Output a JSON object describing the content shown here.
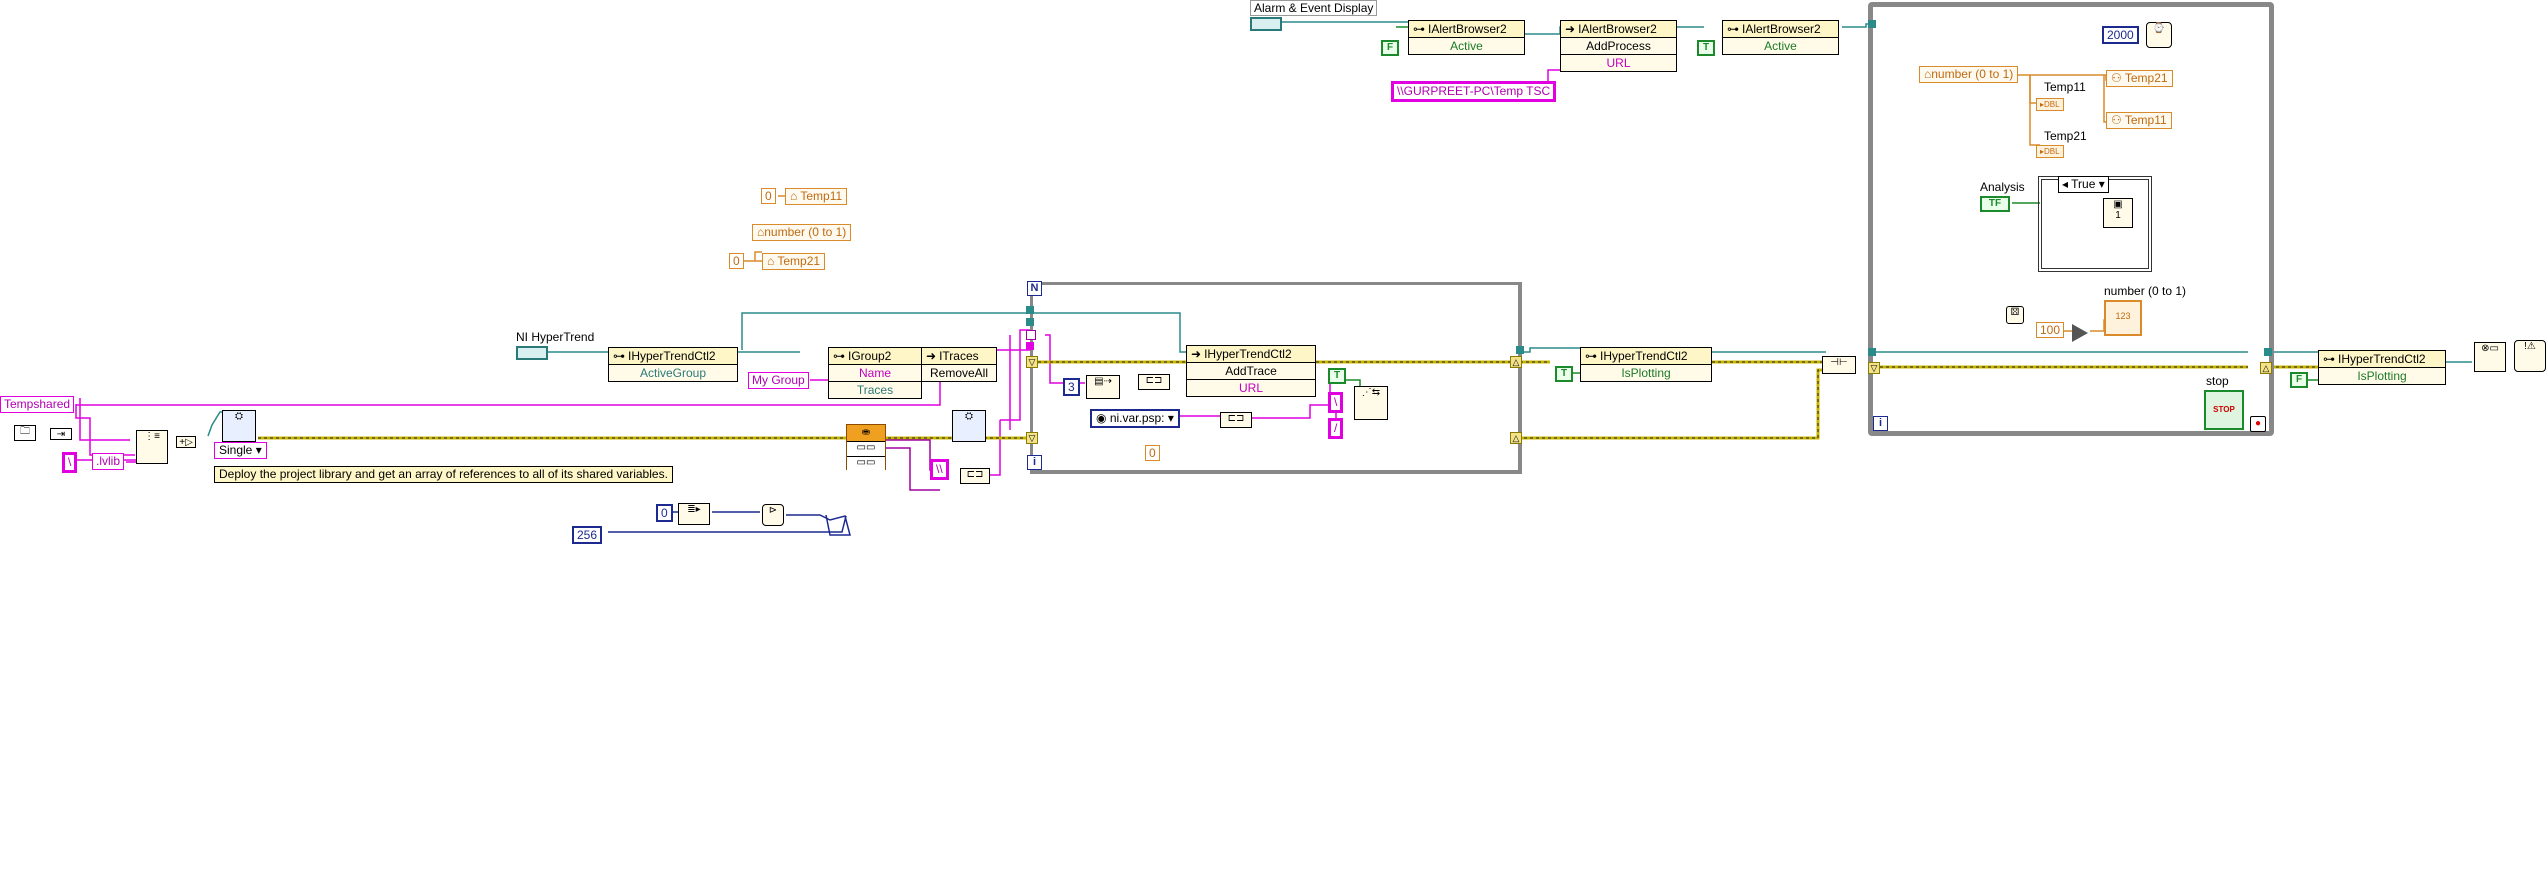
{
  "labels": {
    "alarm_event_display": "Alarm & Event Display",
    "ni_hypertrend": "NI HyperTrend",
    "temp11": "Temp11",
    "temp21": "Temp21",
    "analysis": "Analysis",
    "number_0_1": "number (0 to 1)",
    "stop": "stop"
  },
  "nodes": {
    "ialert1": {
      "class": "IAlertBrowser2",
      "prop": "Active"
    },
    "ialert2": {
      "class": "IAlertBrowser2",
      "method": "AddProcess",
      "arg": "URL"
    },
    "ialert3": {
      "class": "IAlertBrowser2",
      "prop": "Active"
    },
    "ihyper_group": {
      "class": "IHyperTrendCtl2",
      "prop": "ActiveGroup"
    },
    "igroup2": {
      "class": "IGroup2",
      "prop1": "Name",
      "prop2": "Traces"
    },
    "itraces": {
      "class": "ITraces",
      "method": "RemoveAll"
    },
    "ihyper_addtrace": {
      "class": "IHyperTrendCtl2",
      "method": "AddTrace",
      "arg": "URL"
    },
    "ihyper_isplot1": {
      "class": "IHyperTrendCtl2",
      "prop": "IsPlotting"
    },
    "ihyper_isplot2": {
      "class": "IHyperTrendCtl2",
      "prop": "IsPlotting"
    }
  },
  "constants": {
    "gurpreet_path": "\\\\GURPREET-PC\\Temp TSC",
    "my_group": "My Group",
    "tempshared": "Tempshared",
    "backslash": "\\",
    "lvlib": ".lvlib",
    "single": "Single",
    "ni_var_psp": "ni.var.psp:",
    "double_backslash": "\\\\",
    "slash_a": "\\",
    "slash_b": "/",
    "num_2000": "2000",
    "num_100": "100",
    "num_256": "256",
    "num_0_blue": "0",
    "num_0_orange": "0",
    "num_3": "3",
    "lvar_temp11_const": "0",
    "lvar_temp21_const": "0",
    "bool_f1": "F",
    "bool_t1": "T",
    "bool_t2": "T",
    "bool_f2": "F",
    "bool_tf": "TF",
    "case_true": "True",
    "case_true_arrow": "▾",
    "dbl": "DBL",
    "num_123": "123",
    "num_1": "1"
  },
  "local_vars": {
    "temp11": "Temp11",
    "number_0_1": "number (0 to 1)",
    "temp21": "Temp21",
    "loop_number": "number (0 to 1)",
    "loop_temp21": "Temp21",
    "loop_temp11": "Temp11"
  },
  "comment": "Deploy the project library and get an array of references to all of its shared variables.",
  "loops": {
    "for_loop_n": "N",
    "for_loop_i": "i",
    "while_loop_i": "i"
  },
  "icons": {
    "property": "property-node-icon",
    "invoke": "invoke-node-icon",
    "stop": "stop-button-icon",
    "error": "error-handler-icon"
  },
  "colors": {
    "wire_refnum": "#2b8a8a",
    "wire_string": "#e000e0",
    "wire_numeric": "#d98b2b",
    "wire_error": "#c8b400",
    "wire_blue": "#1c2a8f",
    "wire_green": "#1b8a2a",
    "loop_frame": "#888888"
  }
}
